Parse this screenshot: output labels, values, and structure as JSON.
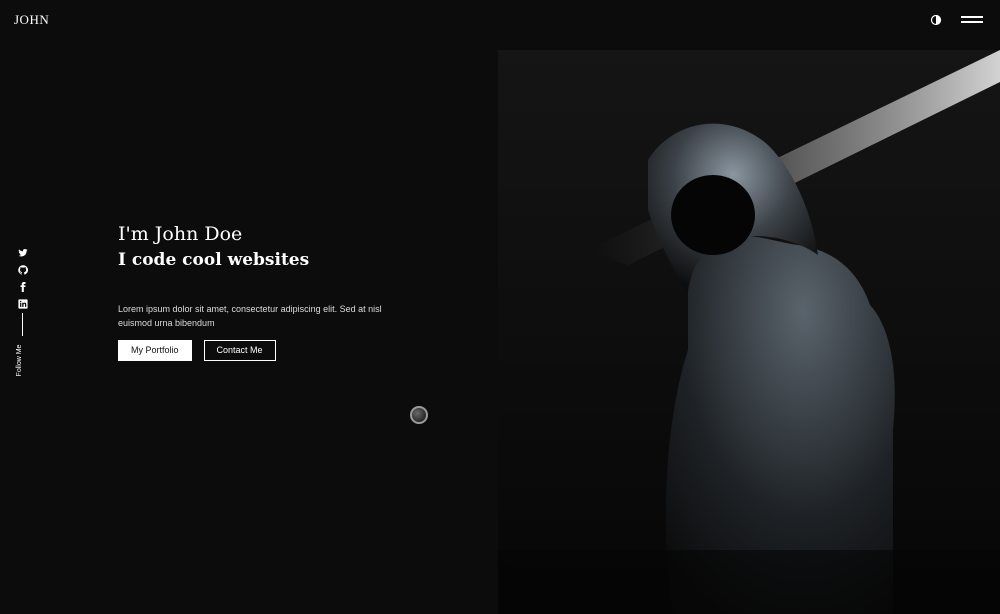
{
  "header": {
    "brand": "JOHN",
    "theme_toggle_icon": "half-circle-icon",
    "menu_icon": "hamburger-menu-icon"
  },
  "social": {
    "items": [
      {
        "icon": "twitter-icon"
      },
      {
        "icon": "github-icon"
      },
      {
        "icon": "facebook-icon"
      },
      {
        "icon": "linkedin-icon"
      }
    ],
    "label": "Follow Me"
  },
  "hero": {
    "greeting": "I'm John Doe",
    "tagline": "I code cool websites",
    "description": "Lorem ipsum dolor sit amet, consectetur adipiscing elit. Sed at nisl euismod urna bibendum",
    "primary_button": "My Portfolio",
    "secondary_button": "Contact Me",
    "image_icon": "hooded-figure-image"
  },
  "colors": {
    "background": "#0c0c0c",
    "text": "#ffffff",
    "button_fill": "#ffffff"
  }
}
